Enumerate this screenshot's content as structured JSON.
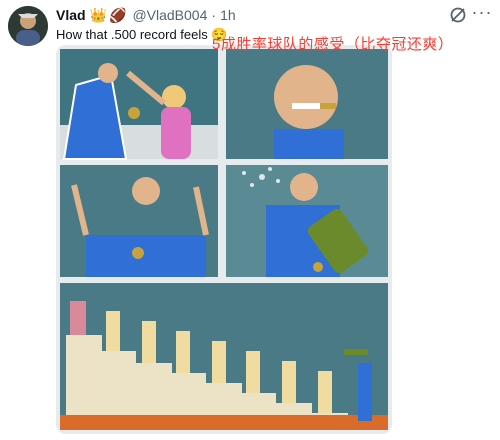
{
  "post": {
    "display_name": "Vlad",
    "badge_emojis": [
      "👑",
      "🏈"
    ],
    "handle": "@VladB004",
    "separator": "·",
    "time": "1h",
    "text": "How that .500 record feels",
    "text_emoji": "😌",
    "overlay_caption": "5成胜率球队的感受（比夺冠还爽）"
  },
  "icons": {
    "grok": "grok-icon",
    "more": "more-options-icon"
  },
  "colors": {
    "accent_text": "#ff3b30",
    "secondary_text": "#536471",
    "comic_bg": "#4a7a85",
    "jacket": "#2f6fd6",
    "medal": "#c8a23a"
  }
}
